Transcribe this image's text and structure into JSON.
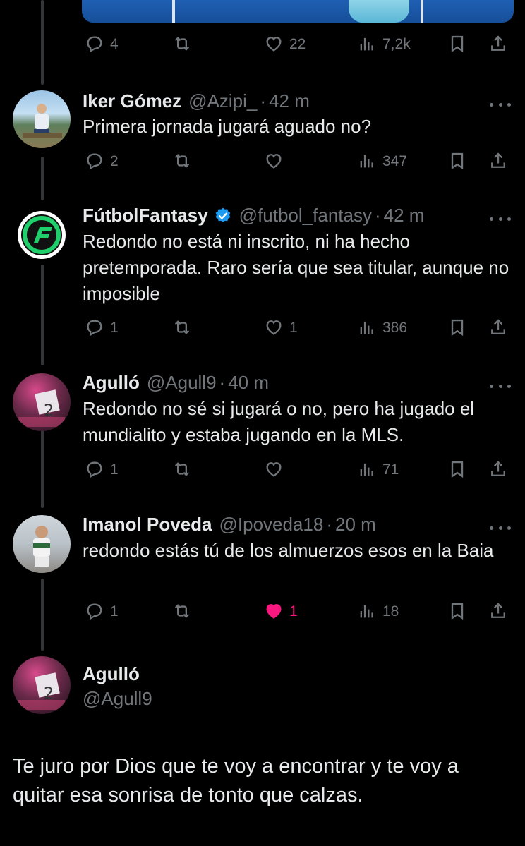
{
  "colors": {
    "background": "#000000",
    "text": "#e7e9ea",
    "muted": "#71767b",
    "like": "#f91880",
    "verified": "#1d9bf0",
    "brand_green": "#1fcf6b"
  },
  "top_actions": {
    "replies": "4",
    "reposts": "",
    "likes": "22",
    "views": "7,2k"
  },
  "replies": [
    {
      "name": "Iker Gómez",
      "handle": "@Azipi_",
      "time": "42 m",
      "text": "Primera jornada jugará aguado no?",
      "replies": "2",
      "reposts": "",
      "likes": "",
      "views": "347",
      "liked": false,
      "verified": false
    },
    {
      "name": "FútbolFantasy",
      "handle": "@futbol_fantasy",
      "time": "42 m",
      "text": "Redondo no está ni inscrito, ni ha hecho pretemporada. Raro sería que sea titular, aunque no imposible",
      "replies": "1",
      "reposts": "",
      "likes": "1",
      "views": "386",
      "liked": false,
      "verified": true
    },
    {
      "name": "Agulló",
      "handle": "@Agull9",
      "time": "40 m",
      "text": "Redondo no sé si jugará o no, pero ha jugado el mundialito y estaba jugando en la MLS.",
      "replies": "1",
      "reposts": "",
      "likes": "",
      "views": "71",
      "liked": false,
      "verified": false
    },
    {
      "name": "Imanol Poveda",
      "handle": "@Ipoveda18",
      "time": "20 m",
      "text": "redondo estás tú de los almuerzos esos en la Baia",
      "replies": "1",
      "reposts": "",
      "likes": "1",
      "views": "18",
      "liked": true,
      "verified": false
    }
  ],
  "main_post": {
    "name": "Agulló",
    "handle": "@Agull9",
    "text": "Te juro por Dios que te voy a encontrar y te voy a quitar esa sonrisa de tonto que calzas."
  }
}
